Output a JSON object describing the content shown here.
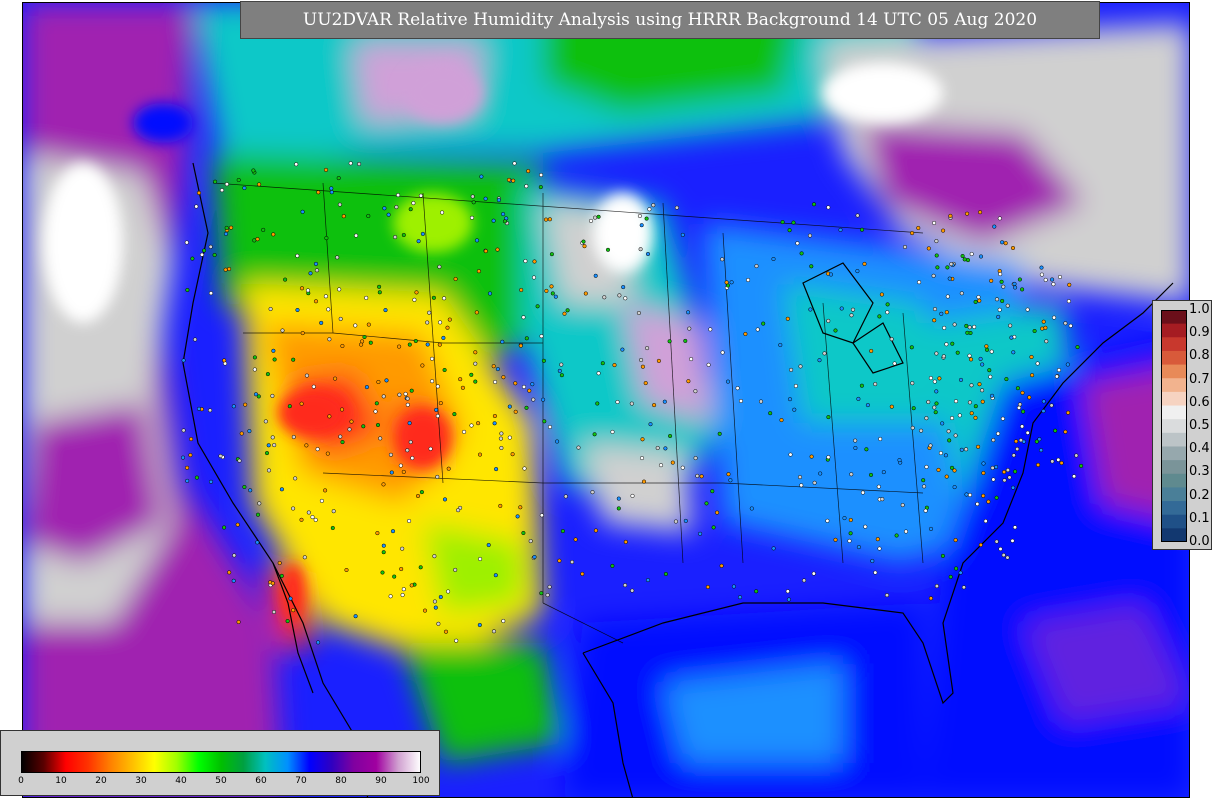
{
  "title": "UU2DVAR Relative Humidity Analysis using HRRR Background 14 UTC 05 Aug 2020",
  "colorbar_right": {
    "ticks": [
      "1.0",
      "0.9",
      "0.8",
      "0.7",
      "0.6",
      "0.5",
      "0.4",
      "0.3",
      "0.2",
      "0.1",
      "0.0"
    ],
    "colors": [
      "#6b0f1a",
      "#a51c22",
      "#c8382d",
      "#d85a3a",
      "#e88a58",
      "#f2b38e",
      "#f6d3c1",
      "#f0f0f0",
      "#dadcdd",
      "#bcc4c7",
      "#96a8ad",
      "#7a9499",
      "#5f8a8f",
      "#4a7f98",
      "#336a97",
      "#1f5087",
      "#123870"
    ]
  },
  "colorbar_bottom": {
    "ticks": [
      "0",
      "10",
      "20",
      "30",
      "40",
      "50",
      "60",
      "70",
      "80",
      "90",
      "100"
    ],
    "gradient": [
      "#000000",
      "#5a0000",
      "#ff0000",
      "#ff3300",
      "#ff7f00",
      "#ffbf00",
      "#ffff00",
      "#a0ff00",
      "#00ff00",
      "#00c000",
      "#00a040",
      "#00c0c0",
      "#0090ff",
      "#0000ff",
      "#3000c0",
      "#8000a0",
      "#a000a0",
      "#d0a0d0",
      "#ffffff"
    ]
  },
  "map_colors": {
    "dry_red": "#ff2a1a",
    "orange": "#ff9a00",
    "yellow": "#ffe600",
    "lime": "#9ef000",
    "green": "#10c010",
    "cyan": "#10c8c8",
    "sky": "#1a90ff",
    "blue": "#0010ff",
    "violet": "#6020e0",
    "purple": "#a020b0",
    "lavender": "#d0a0d8",
    "saturated": "#d0d0d0"
  }
}
